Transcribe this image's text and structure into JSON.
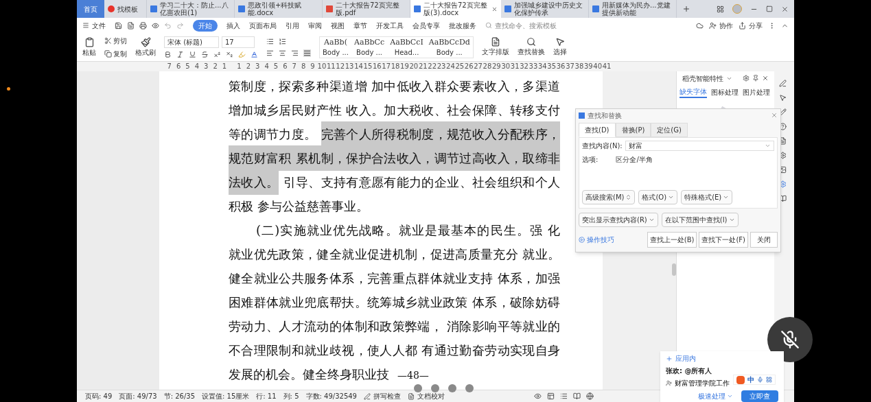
{
  "tabs": [
    {
      "label": "首页",
      "kind": "home",
      "selected": false
    },
    {
      "label": "找模板",
      "kind": "template",
      "selected": false
    },
    {
      "label": "学习二十大：防止...八亿亩农田(1)",
      "kind": "doc",
      "selected": false
    },
    {
      "label": "思政引领+科技赋能.docx",
      "kind": "doc",
      "selected": false
    },
    {
      "label": "二十大报告72页完整版.pdf",
      "kind": "pdf",
      "selected": false
    },
    {
      "label": "二十大报告72页完整版(3).docx",
      "kind": "doc",
      "selected": true
    },
    {
      "label": "加强城乡建设中历史文化保护传承",
      "kind": "doc",
      "selected": false
    },
    {
      "label": "用新媒体为民办...党建提供新动能",
      "kind": "doc",
      "selected": false
    }
  ],
  "menu": {
    "file": "文件",
    "items": [
      {
        "label": "开始",
        "selected": true
      },
      {
        "label": "插入",
        "selected": false
      },
      {
        "label": "页面布局",
        "selected": false
      },
      {
        "label": "引用",
        "selected": false
      },
      {
        "label": "审阅",
        "selected": false
      },
      {
        "label": "视图",
        "selected": false
      },
      {
        "label": "章节",
        "selected": false
      },
      {
        "label": "开发工具",
        "selected": false
      },
      {
        "label": "会员专享",
        "selected": false
      },
      {
        "label": "批改服务",
        "selected": false
      }
    ],
    "search_placeholder": "查找命令、搜索模板",
    "collab": "协作",
    "share": "分享"
  },
  "ribbon": {
    "paste": "粘贴",
    "cut": "剪切",
    "copy": "复制",
    "format_painter": "格式刷",
    "font": "宋体 (标题)",
    "size": "17",
    "styles": [
      {
        "sample": "AaBb(",
        "name": "Body ..."
      },
      {
        "sample": "AaBbCc",
        "name": "Body ..."
      },
      {
        "sample": "AaBbCcI",
        "name": "Head..."
      },
      {
        "sample": "AaBbCcDd",
        "name": "Body ..."
      }
    ],
    "text_layout": "文字排版",
    "find_replace": "查找替换",
    "select": "选择"
  },
  "ruler": [
    "7",
    "6",
    "5",
    "4",
    "3",
    "2",
    "1",
    "1",
    "2",
    "3",
    "4",
    "5",
    "6",
    "7",
    "8",
    "9",
    "10",
    "11",
    "12",
    "13",
    "14",
    "15",
    "16",
    "17",
    "18",
    "19",
    "20",
    "21",
    "22",
    "23",
    "24",
    "25",
    "26",
    "27",
    "28",
    "29",
    "30",
    "31",
    "32",
    "33",
    "34",
    "35",
    "36",
    "37",
    "38",
    "39",
    "40",
    "41"
  ],
  "document": {
    "lines": [
      {
        "kind": "full",
        "indent": false,
        "segments": [
          {
            "text": "策制度，探索多种渠道增 加中低收入群众要素收入，多渠道",
            "highlighted": false
          }
        ]
      },
      {
        "kind": "full",
        "indent": false,
        "segments": [
          {
            "text": "增加城乡居民财产性 收入。加大税收、社会保障、转移支付",
            "highlighted": false
          }
        ]
      },
      {
        "kind": "full",
        "indent": false,
        "segments": [
          {
            "text": "等的调节力度。 ",
            "highlighted": false
          },
          {
            "text": "完善个人所得税制度，规范收入分配秩序，",
            "highlighted": true
          }
        ]
      },
      {
        "kind": "full",
        "indent": false,
        "segments": [
          {
            "text": "规范财富积 累机制，保护合法收入，调节过高收入，取缔非",
            "highlighted": true
          }
        ]
      },
      {
        "kind": "full",
        "indent": false,
        "segments": [
          {
            "text": "法收入。",
            "highlighted": true
          },
          {
            "text": " 引导、支持有意愿有能力的企业、社会组织和个人",
            "highlighted": false
          }
        ]
      },
      {
        "kind": "end",
        "indent": false,
        "segments": [
          {
            "text": "积极  参与公益慈善事业。",
            "highlighted": false
          }
        ]
      },
      {
        "kind": "full",
        "indent": true,
        "segments": [
          {
            "text": "(二)实施就业优先战略。就业是最基本的民生。强  化",
            "highlighted": false
          }
        ]
      },
      {
        "kind": "full",
        "indent": false,
        "segments": [
          {
            "text": "就业优先政策，健全就业促进机制，促进高质量充分 就业。",
            "highlighted": false
          }
        ]
      },
      {
        "kind": "full",
        "indent": false,
        "segments": [
          {
            "text": "健全就业公共服务体系，完善重点群体就业支持 体系，加强",
            "highlighted": false
          }
        ]
      },
      {
        "kind": "full",
        "indent": false,
        "segments": [
          {
            "text": "困难群体就业兜底帮扶。统筹城乡就业政策 体系，破除妨碍",
            "highlighted": false
          }
        ]
      },
      {
        "kind": "full",
        "indent": false,
        "segments": [
          {
            "text": "劳动力、人才流动的体制和政策弊端， 消除影响平等就业的",
            "highlighted": false
          }
        ]
      },
      {
        "kind": "full",
        "indent": false,
        "segments": [
          {
            "text": "不合理限制和就业歧视，使人人都 有通过勤奋劳动实现自身",
            "highlighted": false
          }
        ]
      },
      {
        "kind": "end",
        "indent": false,
        "segments": [
          {
            "text": "发展的机会。健全终身职业技",
            "highlighted": false
          }
        ]
      }
    ],
    "page_number": "—48—"
  },
  "side_panel": {
    "title": "稻壳智能特性",
    "tabs": [
      {
        "label": "缺失字体",
        "selected": true
      },
      {
        "label": "图标处理",
        "selected": false
      },
      {
        "label": "图片处理",
        "selected": false
      }
    ]
  },
  "find_dialog": {
    "title": "查找和替换",
    "tabs": [
      {
        "label": "查找(D)",
        "selected": true
      },
      {
        "label": "替换(P)",
        "selected": false
      },
      {
        "label": "定位(G)",
        "selected": false
      }
    ],
    "find_label": "查找内容(N):",
    "find_value": "财富",
    "options_label": "选项:",
    "options_value": "区分全/半角",
    "advanced": "高级搜索(M)",
    "format": "格式(O)",
    "special": "特殊格式(E)",
    "highlight": "突出显示查找内容(R)",
    "scope": "在以下范围中查找(I)",
    "tips": "操作技巧",
    "prev": "查找上一处(B)",
    "next": "查找下一处(F)",
    "close": "关闭"
  },
  "status_bar": [
    "页码: 49",
    "页面: 49/73",
    "节: 26/35",
    "设置值: 15厘米",
    "行: 11",
    "列: 5",
    "字数: 49/32549"
  ],
  "status_tools": {
    "spell": "拼写检查",
    "proof": "文档校对"
  },
  "notification": {
    "source": "应用内",
    "sender": "张欢: @所有人",
    "group": "财富管理学院工作",
    "ime": "中",
    "quick": "极速处理",
    "view": "立即查"
  }
}
